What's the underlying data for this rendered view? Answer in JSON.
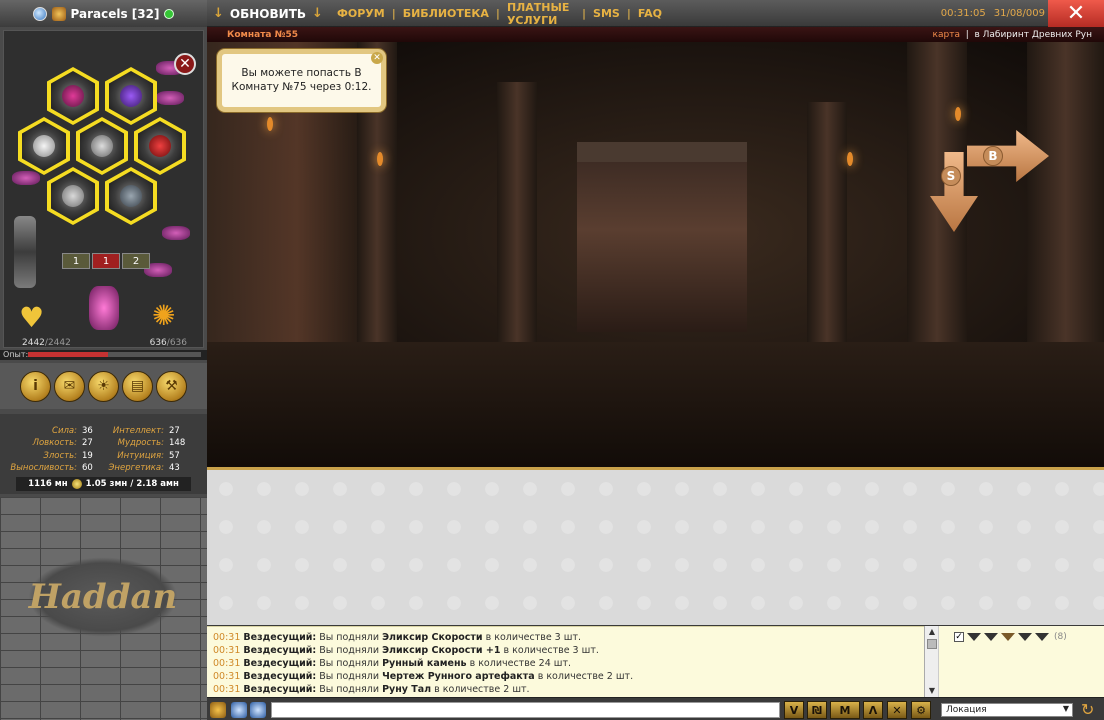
{
  "user": {
    "name": "Paracels",
    "level": "[32]"
  },
  "nav": {
    "refresh": "ОБНОВИТЬ",
    "links": [
      "ФОРУМ",
      "БИБЛИОТЕКА",
      "ПЛАТНЫЕ УСЛУГИ",
      "SMS",
      "FAQ"
    ]
  },
  "clock": {
    "time": "00:31:05",
    "date": "31/08/009"
  },
  "room": {
    "name": "Комната №55",
    "map": "карта",
    "location": "в Лабиринт Древних Рун"
  },
  "tooltip": {
    "line1": "Вы можете попасть В",
    "line2": "Комнату №75 через 0:12."
  },
  "directions": {
    "east": "В",
    "south": "S"
  },
  "slots": [
    "1",
    "1",
    "2"
  ],
  "hp": {
    "cur": "2442",
    "max": "/2442"
  },
  "mp": {
    "cur": "636",
    "max": "/636"
  },
  "exp": {
    "label": "Опыт:",
    "fill": 0.46
  },
  "stats_left": [
    {
      "name": "Сила:",
      "value": "36"
    },
    {
      "name": "Ловкость:",
      "value": "27"
    },
    {
      "name": "Злость:",
      "value": "19"
    },
    {
      "name": "Выносливость:",
      "value": "60"
    }
  ],
  "stats_right": [
    {
      "name": "Интеллект:",
      "value": "27"
    },
    {
      "name": "Мудрость:",
      "value": "148"
    },
    {
      "name": "Интуиция:",
      "value": "57"
    },
    {
      "name": "Энергетика:",
      "value": "43"
    }
  ],
  "money": {
    "mn": "1116 мн",
    "zmn": "1.05 змн / 2.18 амн"
  },
  "logo": "Haddan",
  "chat": [
    {
      "time": "00:31",
      "who": "Вездесущий:",
      "pre": "Вы подняли",
      "item": "Эликсир Скорости",
      "post": "в количестве 3 шт."
    },
    {
      "time": "00:31",
      "who": "Вездесущий:",
      "pre": "Вы подняли",
      "item": "Эликсир Скорости +1",
      "post": "в количестве 3 шт."
    },
    {
      "time": "00:31",
      "who": "Вездесущий:",
      "pre": "Вы подняли",
      "item": "Рунный камень",
      "post": "в количестве 24 шт."
    },
    {
      "time": "00:31",
      "who": "Вездесущий:",
      "pre": "Вы подняли",
      "item": "Чертеж Рунного артефакта",
      "post": "в количестве 2 шт."
    },
    {
      "time": "00:31",
      "who": "Вездесущий:",
      "pre": "Вы подняли",
      "item": "Руну Тал",
      "post": "в количестве 2 шт."
    }
  ],
  "userlist": {
    "checked": "✓",
    "count": "(8)"
  },
  "select": {
    "value": "Локация"
  },
  "action_buttons": [
    "i",
    "✉",
    "☀",
    "▤",
    "⚒"
  ],
  "chat_buttons": [
    "V",
    "₪",
    "M",
    "Λ",
    "✕",
    "⚙"
  ],
  "icons": {
    "close": "✕",
    "down_arrow": "↓",
    "reload": "↻"
  }
}
